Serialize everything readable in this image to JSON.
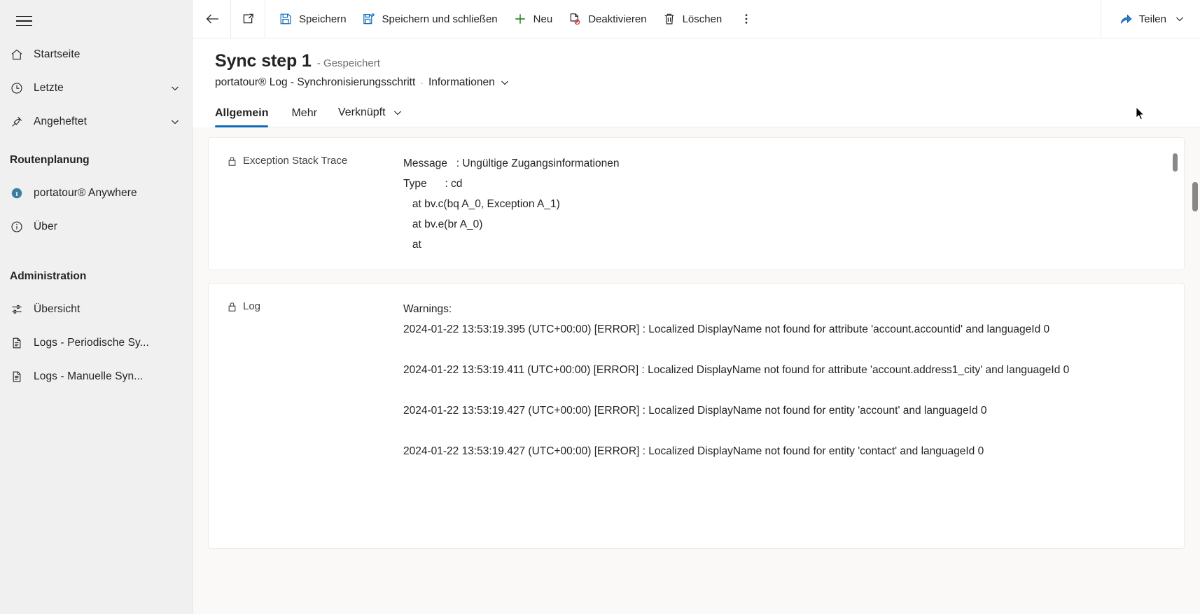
{
  "sidebar": {
    "hamburger_label": "Menü",
    "items": [
      {
        "label": "Startseite",
        "icon": "home-icon",
        "expandable": false
      },
      {
        "label": "Letzte",
        "icon": "clock-icon",
        "expandable": true
      },
      {
        "label": "Angeheftet",
        "icon": "pin-icon",
        "expandable": true
      }
    ],
    "groups": [
      {
        "title": "Routenplanung",
        "items": [
          {
            "label": "portatour® Anywhere",
            "icon": "portatour-logo-icon"
          },
          {
            "label": "Über",
            "icon": "info-icon"
          }
        ]
      },
      {
        "title": "Administration",
        "items": [
          {
            "label": "Übersicht",
            "icon": "settings-sliders-icon"
          },
          {
            "label": "Logs - Periodische Sy...",
            "icon": "document-icon"
          },
          {
            "label": "Logs - Manuelle Syn...",
            "icon": "document-icon"
          }
        ]
      }
    ]
  },
  "commandbar": {
    "back_label": "Zurück",
    "popout_label": "In neuem Fenster öffnen",
    "buttons": [
      {
        "label": "Speichern",
        "icon": "save-icon"
      },
      {
        "label": "Speichern und schließen",
        "icon": "save-and-close-icon"
      },
      {
        "label": "Neu",
        "icon": "plus-icon"
      },
      {
        "label": "Deaktivieren",
        "icon": "deactivate-icon"
      },
      {
        "label": "Löschen",
        "icon": "trash-icon"
      }
    ],
    "overflow_label": "Weitere Befehle",
    "share_label": "Teilen"
  },
  "header": {
    "title": "Sync step 1",
    "state": "- Gespeichert",
    "breadcrumb_entity": "portatour® Log - Synchronisierungsschritt",
    "breadcrumb_sep": "·",
    "breadcrumb_form": "Informationen"
  },
  "tabs": [
    {
      "label": "Allgemein",
      "active": true,
      "has_chevron": false
    },
    {
      "label": "Mehr",
      "active": false,
      "has_chevron": false
    },
    {
      "label": "Verknüpft",
      "active": false,
      "has_chevron": true
    }
  ],
  "fields": {
    "exception": {
      "label": "Exception Stack Trace",
      "locked": true,
      "value": "Message   : Ungültige Zugangsinformationen\nType      : cd\n   at bv.c(bq A_0, Exception A_1)\n   at bv.e(br A_0)\n   at"
    },
    "log": {
      "label": "Log",
      "locked": true,
      "value": "Warnings:\n2024-01-22 13:53:19.395 (UTC+00:00) [ERROR] : Localized DisplayName not found for attribute 'account.accountid' and languageId 0\n\n2024-01-22 13:53:19.411 (UTC+00:00) [ERROR] : Localized DisplayName not found for attribute 'account.address1_city' and languageId 0\n\n2024-01-22 13:53:19.427 (UTC+00:00) [ERROR] : Localized DisplayName not found for entity 'account' and languageId 0\n\n2024-01-22 13:53:19.427 (UTC+00:00) [ERROR] : Localized DisplayName not found for entity 'contact' and languageId 0"
    }
  },
  "colors": {
    "accent": "#0f6cbd",
    "sidebar_bg": "#f0f0f0",
    "content_bg": "#faf9f8",
    "text": "#242424",
    "muted": "#707070",
    "danger": "#d13438",
    "success": "#107c10"
  }
}
